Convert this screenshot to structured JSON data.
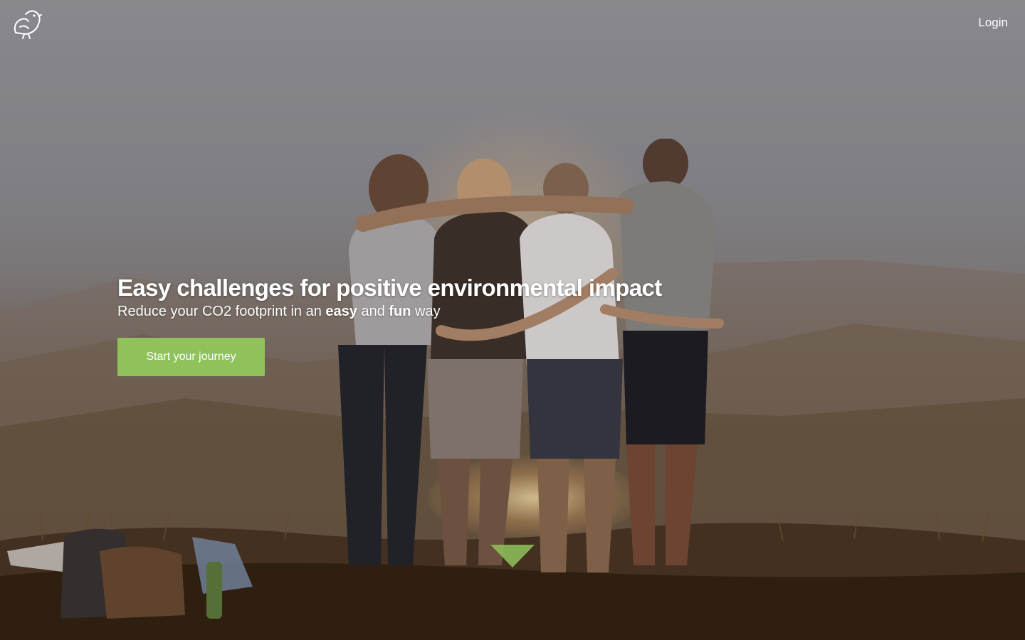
{
  "nav": {
    "logo_icon": "bird-logo-icon",
    "login_label": "Login"
  },
  "hero": {
    "headline": "Easy challenges for positive environmental impact",
    "subline": {
      "part1": "Reduce your CO2 footprint in an ",
      "emphasis1": "easy",
      "part2": " and ",
      "emphasis2": "fun",
      "part3": " way"
    },
    "cta_label": "Start your journey",
    "scroll_icon": "chevron-down-triangle-icon"
  },
  "colors": {
    "accent": "#8fc25a",
    "text": "#ffffff"
  }
}
